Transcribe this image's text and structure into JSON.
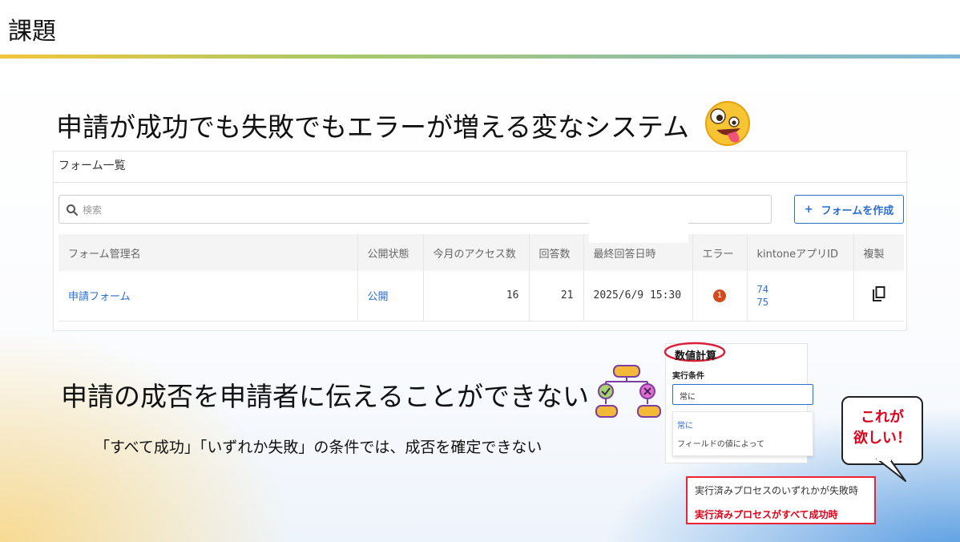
{
  "slide": {
    "section_title": "課題",
    "headline_1": "申請が成功でも失敗でもエラーが増える変なシステム",
    "headline_2": "申請の成否を申請者に伝えることができない",
    "subline": "「すべて成功」「いずれか失敗」の条件では、成否を確定できない"
  },
  "form_list": {
    "title": "フォーム一覧",
    "search_placeholder": "検索",
    "create_button": {
      "icon": "+",
      "label": "フォームを作成"
    },
    "columns": [
      "フォーム管理名",
      "公開状態",
      "今月のアクセス数",
      "回答数",
      "最終回答日時",
      "エラー",
      "kintoneアプリID",
      "複製"
    ],
    "rows": [
      {
        "name": "申請フォーム",
        "status": "公開",
        "access": "16",
        "answers": "21",
        "last_answer": "2025/6/9 15:30",
        "errors": "1",
        "app_id_1": "74",
        "app_id_2": "75",
        "copy_icon": "copy-icon"
      }
    ]
  },
  "calc_panel": {
    "title": "数値計算",
    "label": "実行条件",
    "selected": "常に",
    "options": [
      "常に",
      "フィールドの値によって"
    ]
  },
  "bubble": {
    "line1": "これが",
    "line2": "欲しい！"
  },
  "conditions": [
    "実行済みプロセスのいずれかが失敗時",
    "実行済みプロセスがすべて成功時"
  ],
  "colors": {
    "link": "#2b6ed2",
    "accent_red": "#e0001a",
    "error_badge": "#d34a1c"
  }
}
